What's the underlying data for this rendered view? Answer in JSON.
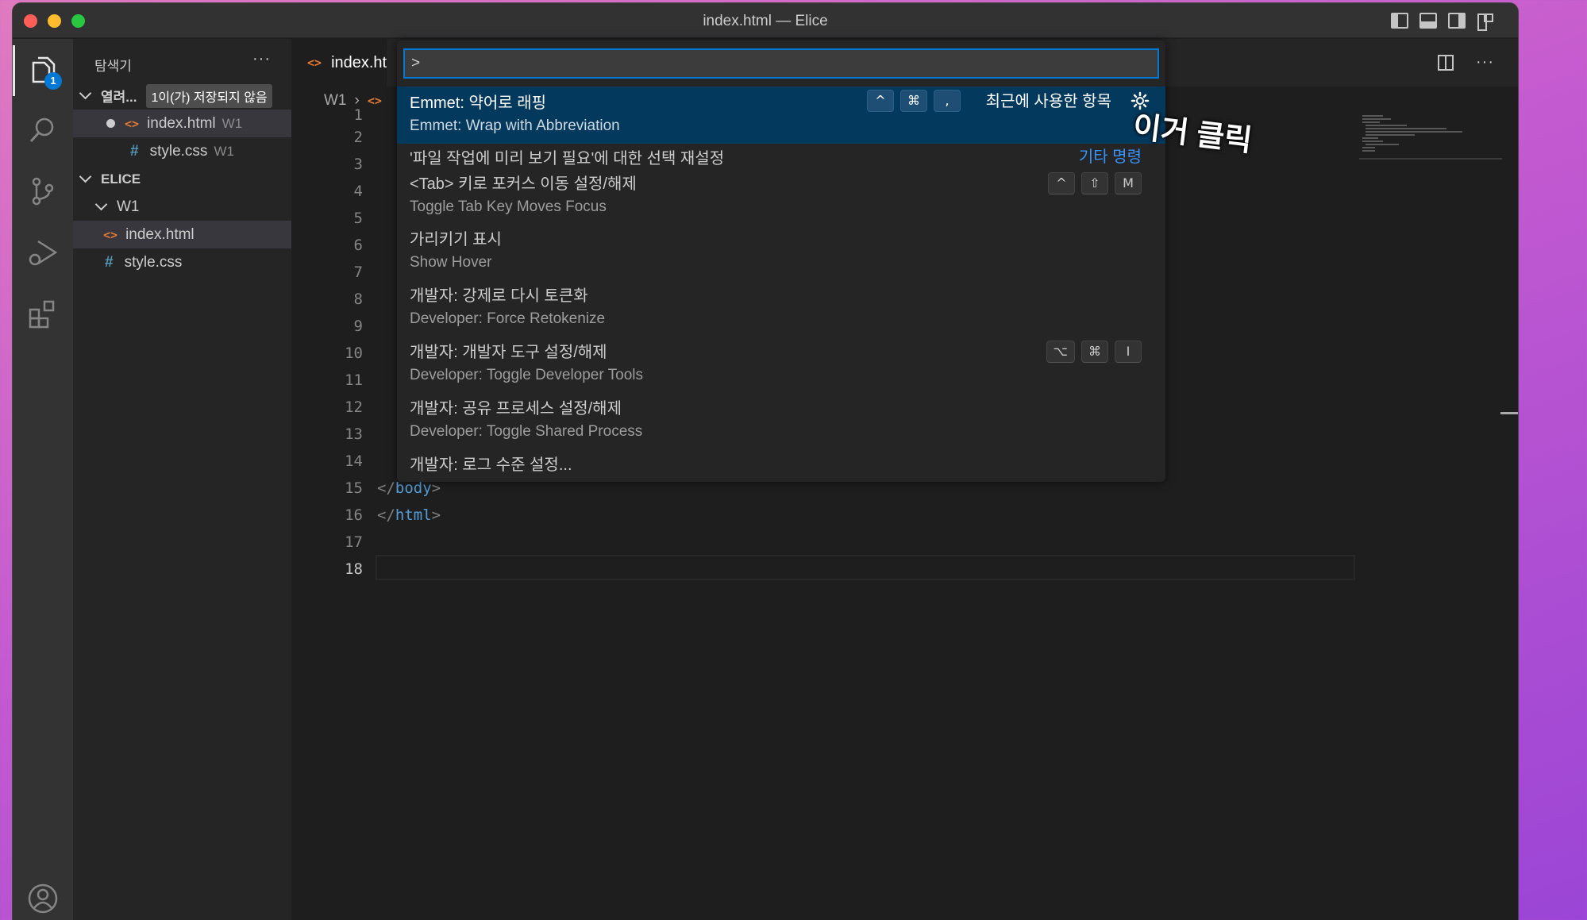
{
  "window": {
    "title": "index.html — Elice"
  },
  "activity_bar": {
    "explorer_badge": "1"
  },
  "sidebar": {
    "title": "탐색기",
    "more": "···",
    "open_editors": {
      "label": "열려...",
      "unsaved_badge": "1이(가) 저장되지 않음",
      "items": [
        {
          "name": "index.html",
          "desc": "W1",
          "type": "html",
          "modified": true
        },
        {
          "name": "style.css",
          "desc": "W1",
          "type": "css",
          "modified": false
        }
      ]
    },
    "workspace": {
      "label": "ELICE",
      "folder": "W1",
      "files": [
        {
          "name": "index.html",
          "type": "html",
          "selected": true
        },
        {
          "name": "style.css",
          "type": "css",
          "selected": false
        }
      ]
    }
  },
  "tab": {
    "label": "index.html"
  },
  "breadcrumb": {
    "folder": "W1"
  },
  "editor": {
    "line_numbers": [
      "1",
      "2",
      "3",
      "4",
      "5",
      "6",
      "7",
      "8",
      "9",
      "10",
      "11",
      "12",
      "13",
      "14",
      "15",
      "16",
      "17",
      "18"
    ],
    "current_line": "18",
    "visible_code": [
      {
        "line": "15",
        "open": "</",
        "tag": "body",
        "close": ">"
      },
      {
        "line": "16",
        "open": "</",
        "tag": "html",
        "close": ">"
      }
    ]
  },
  "command_palette": {
    "input_value": ">",
    "recent_label": "최근에 사용한 항목",
    "other_label": "기타 명령",
    "items": [
      {
        "main": "Emmet: 약어로 래핑",
        "sub": "Emmet: Wrap with Abbreviation",
        "keys": [
          "^",
          "⌘",
          ","
        ],
        "focused": true
      },
      {
        "main": "'파일 작업에 미리 보기 필요'에 대한 선택 재설정",
        "sub": "",
        "keys": []
      },
      {
        "main": "<Tab> 키로 포커스 이동 설정/해제",
        "sub": "Toggle Tab Key Moves Focus",
        "keys": [
          "^",
          "⇧",
          "M"
        ]
      },
      {
        "main": "가리키기 표시",
        "sub": "Show Hover",
        "keys": []
      },
      {
        "main": "개발자: 강제로 다시 토큰화",
        "sub": "Developer: Force Retokenize",
        "keys": []
      },
      {
        "main": "개발자: 개발자 도구 설정/해제",
        "sub": "Developer: Toggle Developer Tools",
        "keys": [
          "⌥",
          "⌘",
          "I"
        ]
      },
      {
        "main": "개발자: 공유 프로세스 설정/해제",
        "sub": "Developer: Toggle Shared Process",
        "keys": []
      },
      {
        "main": "개발자: 로그 수준 설정...",
        "sub": "",
        "keys": []
      }
    ]
  },
  "annotation": {
    "text": "이거 클릭"
  },
  "colors": {
    "accent": "#0078d4",
    "focused_row": "#04395e",
    "link": "#3794ff",
    "html_icon": "#e37933",
    "css_icon": "#519aba"
  }
}
